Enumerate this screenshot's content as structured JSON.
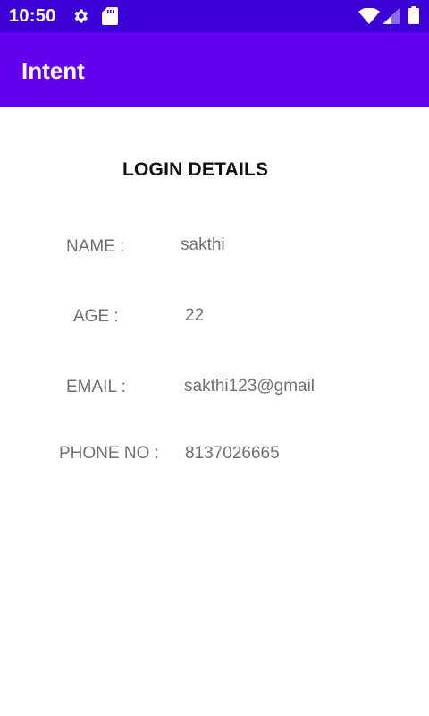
{
  "status_bar": {
    "time": "10:50",
    "background": "#3a00d6",
    "icons": [
      "gear-icon",
      "sd-card-icon",
      "wifi-icon",
      "signal-icon",
      "battery-icon"
    ]
  },
  "app_bar": {
    "title": "Intent",
    "background": "#6200ee"
  },
  "content": {
    "heading": "LOGIN DETAILS",
    "fields": [
      {
        "label": "NAME :",
        "value": "sakthi"
      },
      {
        "label": "AGE :",
        "value": "22"
      },
      {
        "label": "EMAIL :",
        "value": "sakthi123@gmail"
      },
      {
        "label": "PHONE NO :",
        "value": "8137026665"
      }
    ]
  }
}
